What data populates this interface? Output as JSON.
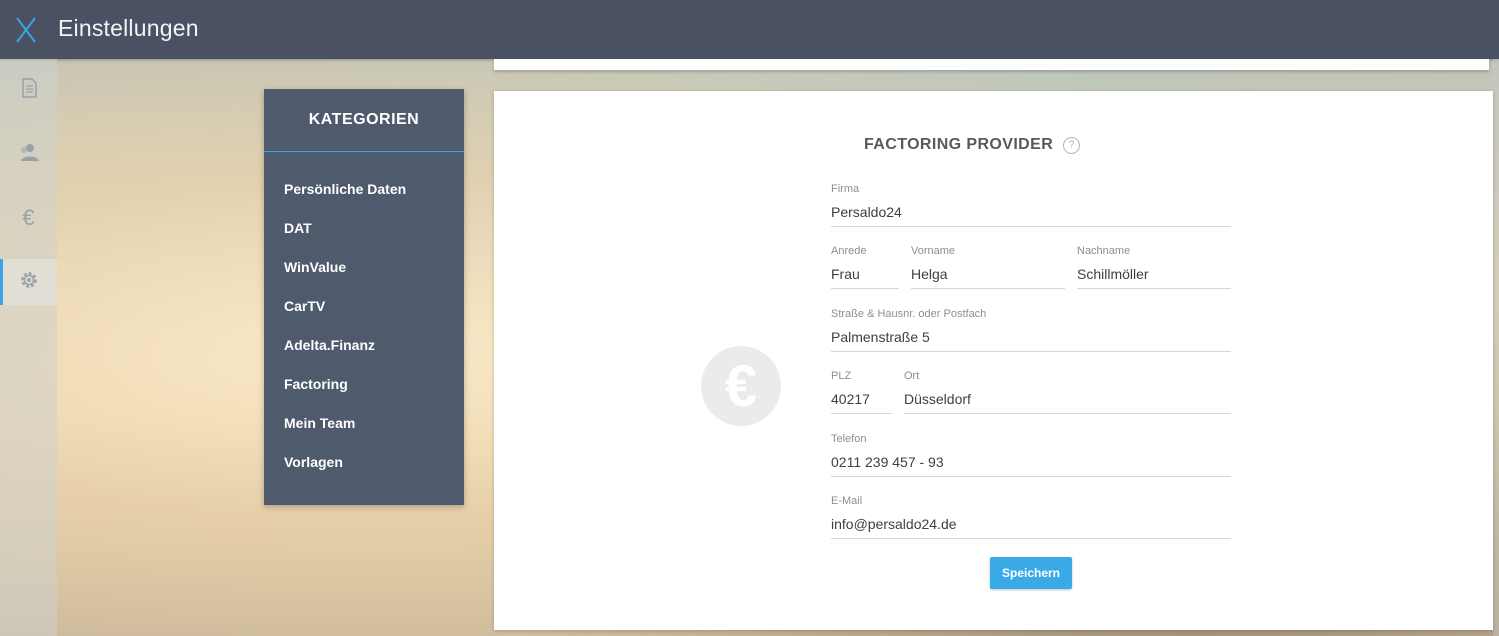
{
  "app": {
    "title": "Einstellungen",
    "logo_icon": "x-logo-icon"
  },
  "leftnav": {
    "items": [
      {
        "name": "document-icon",
        "active": false
      },
      {
        "name": "users-icon",
        "active": false
      },
      {
        "name": "euro-icon",
        "glyph": "€",
        "active": false
      },
      {
        "name": "gear-icon",
        "active": true
      }
    ]
  },
  "categories": {
    "title": "KATEGORIEN",
    "items": [
      "Persönliche Daten",
      "DAT",
      "WinValue",
      "CarTV",
      "Adelta.Finanz",
      "Factoring",
      "Mein Team",
      "Vorlagen"
    ]
  },
  "form": {
    "title": "FACTORING PROVIDER",
    "help_glyph": "?",
    "watermark_glyph": "€",
    "firma": {
      "label": "Firma",
      "value": "Persaldo24"
    },
    "anrede": {
      "label": "Anrede",
      "value": "Frau"
    },
    "vorname": {
      "label": "Vorname",
      "value": "Helga"
    },
    "nachname": {
      "label": "Nachname",
      "value": "Schillmöller"
    },
    "strasse": {
      "label": "Straße & Hausnr. oder Postfach",
      "value": "Palmenstraße 5"
    },
    "plz": {
      "label": "PLZ",
      "value": "40217"
    },
    "ort": {
      "label": "Ort",
      "value": "Düsseldorf"
    },
    "telefon": {
      "label": "Telefon",
      "value": "0211 239 457 - 93"
    },
    "email": {
      "label": "E-Mail",
      "value": "info@persaldo24.de"
    },
    "save_label": "Speichern"
  },
  "colors": {
    "topbar": "#4a5162",
    "panel": "#4f5a6d",
    "accent": "#3aa3e3",
    "button": "#3aa9e8"
  }
}
